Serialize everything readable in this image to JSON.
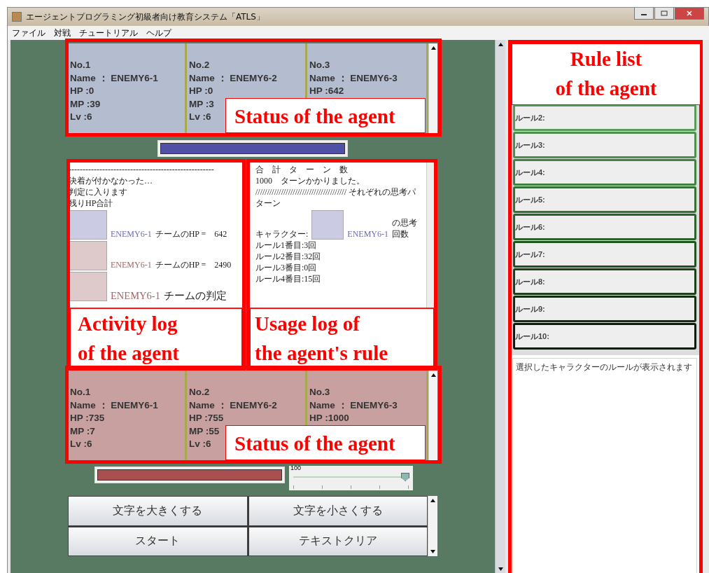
{
  "window": {
    "title": "エージェントプログラミング初級者向け教育システム「ATLS」"
  },
  "menu": [
    "ファイル",
    "対戦",
    "チュートリアル",
    "ヘルプ"
  ],
  "ally_status": {
    "annotation": "Status of the agent",
    "agents": [
      {
        "lines": [
          "No.1",
          "Name ： ENEMY6-1",
          "HP :0",
          "MP :39",
          "Lv :6"
        ]
      },
      {
        "lines": [
          "No.2",
          "Name ： ENEMY6-2",
          "HP :0",
          "MP :3",
          "Lv :6"
        ]
      },
      {
        "lines": [
          "No.3",
          "Name ： ENEMY6-3",
          "HP :642"
        ]
      }
    ]
  },
  "ally_bar": {
    "level": 1
  },
  "activity_log": {
    "annotation": "Activity log\nof the agent",
    "entries": [
      {
        "kind": "text",
        "text": "----------------------------------------------------"
      },
      {
        "kind": "text",
        "text": "決着が付かなかった…"
      },
      {
        "kind": "text",
        "text": "判定に入ります"
      },
      {
        "kind": "text",
        "text": "残りHP合計"
      },
      {
        "kind": "team",
        "color": "#6a6ab0",
        "name": "ENEMY6-1",
        "text": "チームのHP =　642"
      },
      {
        "kind": "team",
        "color": "#a06868",
        "name": "ENEMY6-1",
        "text": "チームのHP =　2490"
      },
      {
        "kind": "team_large",
        "color": "#a06868",
        "name": "ENEMY6-1",
        "text": "チームの判定"
      }
    ]
  },
  "rule_log": {
    "annotation": "Usage log of\nthe agent's rule",
    "entries": [
      {
        "kind": "text",
        "text": "合　計　タ　ー　ン　数"
      },
      {
        "kind": "text",
        "text": "1000　ターンかかりました。"
      },
      {
        "kind": "text",
        "text": "/////////////////////////////////////// それぞれの思考パターン"
      },
      {
        "kind": "character",
        "label": "キャラクター:",
        "color": "#6a6ab0",
        "name": "ENEMY6-1",
        "text": "の思考回数"
      },
      {
        "kind": "text",
        "text": "ルール1番目:3回"
      },
      {
        "kind": "text",
        "text": "ルール2番目:32回"
      },
      {
        "kind": "text",
        "text": "ルール3番目:0回"
      },
      {
        "kind": "text",
        "text": "ルール4番目:15回"
      }
    ]
  },
  "enemy_status": {
    "annotation": "Status of the agent",
    "agents": [
      {
        "lines": [
          "No.1",
          "Name ： ENEMY6-1",
          "HP :735",
          "MP :7",
          "Lv :6"
        ]
      },
      {
        "lines": [
          "No.2",
          "Name ： ENEMY6-2",
          "HP :755",
          "MP :55",
          "Lv :6"
        ]
      },
      {
        "lines": [
          "No.3",
          "Name ： ENEMY6-3",
          "HP :1000"
        ]
      }
    ]
  },
  "enemy_bar": {
    "level": 1
  },
  "speed_slider": {
    "reading": "100",
    "level": 0.97
  },
  "buttons": [
    "文字を大きくする",
    "文字を小さくする",
    "スタート",
    "テキストクリア"
  ],
  "rule_list": {
    "annotation": "Rule list\nof the agent",
    "rules": [
      {
        "label": "ルール2:",
        "color": "#5a9a5a"
      },
      {
        "label": "ルール3:",
        "color": "#4e8e4e"
      },
      {
        "label": "ルール4:",
        "color": "#418141"
      },
      {
        "label": "ルール5:",
        "color": "#367236"
      },
      {
        "label": "ルール6:",
        "color": "#2c632c"
      },
      {
        "label": "ルール7:",
        "color": "#225222"
      },
      {
        "label": "ルール8:",
        "color": "#1a401a"
      },
      {
        "label": "ルール9:",
        "color": "#132e13"
      },
      {
        "label": "ルール10:",
        "color": "#0c1c0c"
      }
    ],
    "description": "選択したキャラクターのルールが表示されます"
  }
}
